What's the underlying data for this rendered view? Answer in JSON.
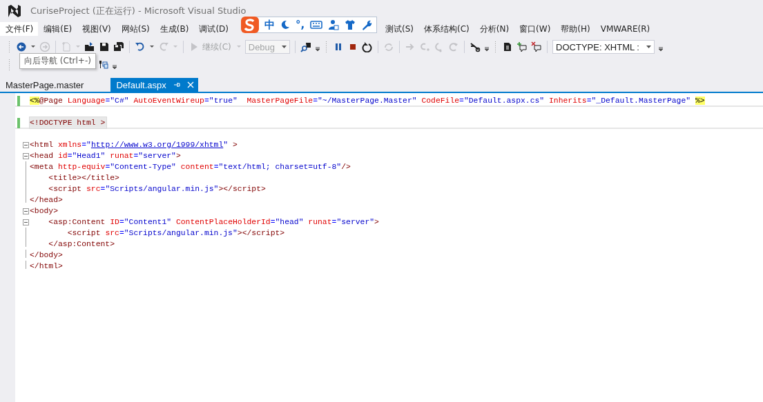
{
  "window": {
    "title": "CuriseProject (正在运行) - Microsoft Visual Studio"
  },
  "menu": [
    {
      "label": "文件(F)",
      "selected": true
    },
    {
      "label": "编辑(E)",
      "selected": false
    },
    {
      "label": "视图(V)",
      "selected": false
    },
    {
      "label": "网站(S)",
      "selected": false
    },
    {
      "label": "生成(B)",
      "selected": false
    },
    {
      "label": "调试(D)",
      "selected": false
    },
    {
      "label": "测试(S)",
      "selected": false
    },
    {
      "label": "体系结构(C)",
      "selected": false
    },
    {
      "label": "分析(N)",
      "selected": false
    },
    {
      "label": "窗口(W)",
      "selected": false
    },
    {
      "label": "帮助(H)",
      "selected": false
    },
    {
      "label": "VMWARE(R)",
      "selected": false
    }
  ],
  "ime_toolbar": {
    "mode": "中",
    "punct": "°,"
  },
  "toolbar": [
    {
      "kind": "grip"
    },
    {
      "kind": "back",
      "disabled": false
    },
    {
      "kind": "caret",
      "disabled": false
    },
    {
      "kind": "forward",
      "disabled": true
    },
    {
      "kind": "separator"
    },
    {
      "kind": "new-item",
      "disabled": true
    },
    {
      "kind": "caret",
      "disabled": true
    },
    {
      "kind": "open",
      "disabled": false
    },
    {
      "kind": "save",
      "disabled": false
    },
    {
      "kind": "save-all",
      "disabled": false
    },
    {
      "kind": "separator"
    },
    {
      "kind": "undo",
      "disabled": false
    },
    {
      "kind": "caret",
      "disabled": false
    },
    {
      "kind": "redo",
      "disabled": true
    },
    {
      "kind": "caret",
      "disabled": true
    },
    {
      "kind": "separator"
    },
    {
      "kind": "continue",
      "label": "继续(C)",
      "disabled": true
    },
    {
      "kind": "caret",
      "disabled": true
    },
    {
      "kind": "combo",
      "value": "Debug",
      "disabled": true
    },
    {
      "kind": "separator"
    },
    {
      "kind": "find",
      "disabled": false
    },
    {
      "kind": "overflow"
    },
    {
      "kind": "grip"
    },
    {
      "kind": "pause",
      "disabled": false
    },
    {
      "kind": "stop",
      "disabled": false
    },
    {
      "kind": "restart",
      "disabled": false
    },
    {
      "kind": "separator"
    },
    {
      "kind": "refresh",
      "disabled": true
    },
    {
      "kind": "separator"
    },
    {
      "kind": "next",
      "disabled": true
    },
    {
      "kind": "step-into",
      "disabled": true
    },
    {
      "kind": "step-over",
      "disabled": true
    },
    {
      "kind": "step-out",
      "disabled": true
    },
    {
      "kind": "separator"
    },
    {
      "kind": "breakpoints",
      "disabled": false
    },
    {
      "kind": "overflow"
    },
    {
      "kind": "grip"
    },
    {
      "kind": "document",
      "disabled": false
    },
    {
      "kind": "comment-add",
      "disabled": false
    },
    {
      "kind": "comment-remove",
      "disabled": false
    },
    {
      "kind": "separator"
    },
    {
      "kind": "combo",
      "value": "DOCTYPE:  XHTML :",
      "disabled": false
    },
    {
      "kind": "overflow"
    }
  ],
  "toolbar_2": [
    {
      "kind": "grip"
    },
    {
      "kind": "tools",
      "disabled": false
    },
    {
      "kind": "overflow"
    }
  ],
  "tooltip": "向后导航 (Ctrl+-)",
  "tabs": [
    {
      "label": "MasterPage.master",
      "selected": false
    },
    {
      "label": "Default.aspx",
      "selected": true
    }
  ],
  "editor": {
    "lines": [
      {
        "kind": "plain",
        "modified": true,
        "current": false,
        "divider": true,
        "tokens": [
          {
            "kind": "directive",
            "text": "<%"
          },
          {
            "kind": "tag",
            "text": "@Page "
          },
          {
            "kind": "attr",
            "text": "Language"
          },
          {
            "kind": "eq",
            "text": "="
          },
          {
            "kind": "value",
            "text": "\"C#\" "
          },
          {
            "kind": "attr",
            "text": "AutoEventWireup"
          },
          {
            "kind": "eq",
            "text": "="
          },
          {
            "kind": "value",
            "text": "\"true\"  "
          },
          {
            "kind": "attr",
            "text": "MasterPageFile"
          },
          {
            "kind": "eq",
            "text": "="
          },
          {
            "kind": "value",
            "text": "\"~/MasterPage.Master\" "
          },
          {
            "kind": "attr",
            "text": "CodeFile"
          },
          {
            "kind": "eq",
            "text": "="
          },
          {
            "kind": "value",
            "text": "\"Default.aspx.cs\" "
          },
          {
            "kind": "attr",
            "text": "Inherits"
          },
          {
            "kind": "eq",
            "text": "="
          },
          {
            "kind": "value",
            "text": "\"_Default.MasterPage\" "
          },
          {
            "kind": "directive",
            "text": "%>"
          }
        ]
      },
      {
        "kind": "plain",
        "modified": false,
        "current": false,
        "divider": false
      },
      {
        "kind": "plain",
        "modified": true,
        "current": true,
        "divider": true,
        "tokens": [
          {
            "kind": "tag",
            "text": "<!DOCTYPE html >"
          }
        ]
      },
      {
        "kind": "plain",
        "modified": false,
        "current": false,
        "divider": false
      },
      {
        "kind": "open",
        "modified": false,
        "current": false,
        "divider": false,
        "tokens": [
          {
            "kind": "tag",
            "text": "<html "
          },
          {
            "kind": "attr",
            "text": "xmlns"
          },
          {
            "kind": "eq",
            "text": "="
          },
          {
            "kind": "value",
            "text": "\""
          },
          {
            "kind": "link",
            "text": "http://www.w3.org/1999/xhtml"
          },
          {
            "kind": "value",
            "text": "\" "
          },
          {
            "kind": "tag",
            "text": ">"
          }
        ]
      },
      {
        "kind": "open",
        "modified": false,
        "current": false,
        "divider": false,
        "tokens": [
          {
            "kind": "tag",
            "text": "<head "
          },
          {
            "kind": "attr",
            "text": "id"
          },
          {
            "kind": "eq",
            "text": "="
          },
          {
            "kind": "value",
            "text": "\"Head1\" "
          },
          {
            "kind": "attr",
            "text": "runat"
          },
          {
            "kind": "eq",
            "text": "="
          },
          {
            "kind": "value",
            "text": "\"server\""
          },
          {
            "kind": "tag",
            "text": ">"
          }
        ]
      },
      {
        "kind": "inner",
        "modified": false,
        "current": false,
        "divider": false,
        "tokens": [
          {
            "kind": "tag",
            "text": "<meta "
          },
          {
            "kind": "attr",
            "text": "http-equiv"
          },
          {
            "kind": "eq",
            "text": "="
          },
          {
            "kind": "value",
            "text": "\"Content-Type\" "
          },
          {
            "kind": "attr",
            "text": "content"
          },
          {
            "kind": "eq",
            "text": "="
          },
          {
            "kind": "value",
            "text": "\"text/html; charset=utf-8\""
          },
          {
            "kind": "tag",
            "text": "/>"
          }
        ]
      },
      {
        "kind": "inner",
        "modified": false,
        "current": false,
        "divider": false,
        "tokens": [
          {
            "kind": "tag",
            "text": "    <title></title>"
          }
        ]
      },
      {
        "kind": "inner",
        "modified": false,
        "current": false,
        "divider": false,
        "tokens": [
          {
            "kind": "tag",
            "text": "    <script "
          },
          {
            "kind": "attr",
            "text": "src"
          },
          {
            "kind": "eq",
            "text": "="
          },
          {
            "kind": "value",
            "text": "\"Scripts/angular.min.js\""
          },
          {
            "kind": "tag",
            "text": "></script>"
          }
        ]
      },
      {
        "kind": "end",
        "modified": false,
        "current": false,
        "divider": false,
        "tokens": [
          {
            "kind": "tag",
            "text": "</head>"
          }
        ]
      },
      {
        "kind": "open",
        "modified": false,
        "current": false,
        "divider": false,
        "tokens": [
          {
            "kind": "tag",
            "text": "<body>"
          }
        ]
      },
      {
        "kind": "open",
        "modified": false,
        "current": false,
        "divider": false,
        "tokens": [
          {
            "kind": "tag",
            "text": "    <asp:Content "
          },
          {
            "kind": "attr",
            "text": "ID"
          },
          {
            "kind": "eq",
            "text": "="
          },
          {
            "kind": "value",
            "text": "\"Content1\" "
          },
          {
            "kind": "attr",
            "text": "ContentPlaceHolderId"
          },
          {
            "kind": "eq",
            "text": "="
          },
          {
            "kind": "value",
            "text": "\"head\" "
          },
          {
            "kind": "attr",
            "text": "runat"
          },
          {
            "kind": "eq",
            "text": "="
          },
          {
            "kind": "value",
            "text": "\"server\""
          },
          {
            "kind": "tag",
            "text": ">"
          }
        ]
      },
      {
        "kind": "inner",
        "modified": false,
        "current": false,
        "divider": false,
        "tokens": [
          {
            "kind": "tag",
            "text": "        <script "
          },
          {
            "kind": "attr",
            "text": "src"
          },
          {
            "kind": "eq",
            "text": "="
          },
          {
            "kind": "value",
            "text": "\"Scripts/angular.min.js\""
          },
          {
            "kind": "tag",
            "text": "></script>"
          }
        ]
      },
      {
        "kind": "end",
        "modified": false,
        "current": false,
        "divider": false,
        "tokens": [
          {
            "kind": "tag",
            "text": "    </asp:Content>"
          }
        ]
      },
      {
        "kind": "end",
        "modified": false,
        "current": false,
        "divider": false,
        "tokens": [
          {
            "kind": "tag",
            "text": "</body>"
          }
        ]
      },
      {
        "kind": "end",
        "modified": false,
        "current": false,
        "divider": false,
        "tokens": [
          {
            "kind": "tag",
            "text": "</html>"
          }
        ]
      }
    ]
  }
}
